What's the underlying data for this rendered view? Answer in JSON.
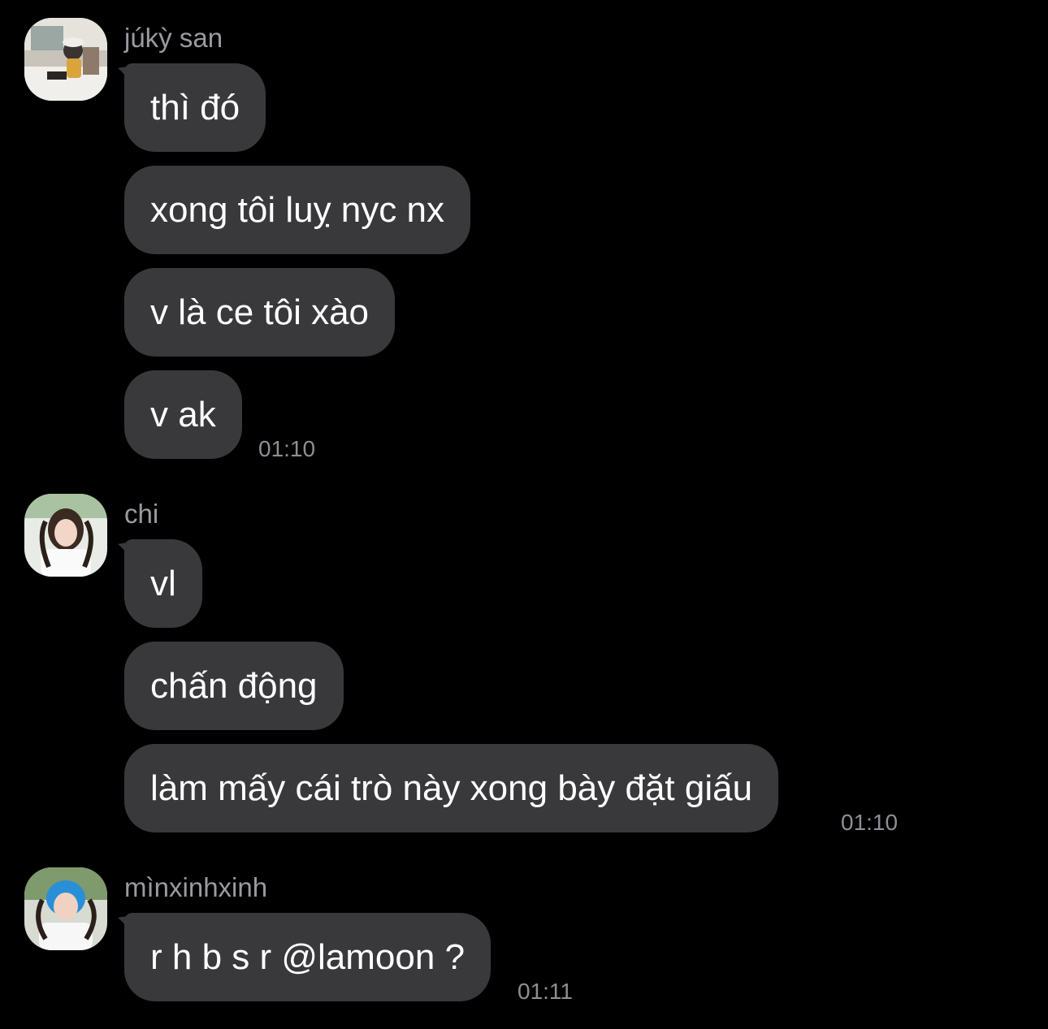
{
  "groups": [
    {
      "sender": "júkỳ san",
      "avatar_icon": "profile-photo-icon",
      "messages": [
        "thì đó",
        "xong tôi luỵ nyc nx",
        "v là ce tôi xào",
        "v ak"
      ],
      "time": "01:10"
    },
    {
      "sender": "chi",
      "avatar_icon": "profile-photo-icon",
      "messages": [
        "vl",
        "chấn động",
        "làm mấy cái trò này xong bày đặt giấu"
      ],
      "time": "01:10"
    },
    {
      "sender": "mìnxinhxinh",
      "avatar_icon": "profile-photo-icon",
      "messages": [
        "r h b s r @lamoon ?"
      ],
      "time": "01:11"
    }
  ],
  "colors": {
    "background": "#000000",
    "bubble": "#39393c",
    "message_text": "#ffffff",
    "sender_text": "#9a9a9f",
    "time_text": "#8e8e93"
  }
}
